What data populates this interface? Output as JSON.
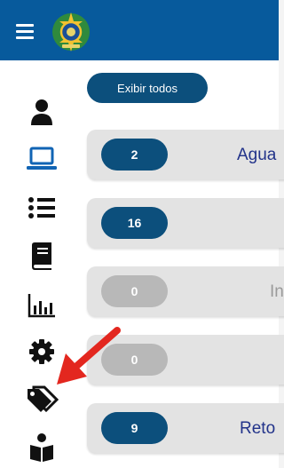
{
  "header": {
    "menu_icon": "hamburger-menu-icon",
    "emblem_icon": "brazil-coat-of-arms",
    "background_color": "#075a9c"
  },
  "sidebar": {
    "items": [
      {
        "icon": "user-icon",
        "active": false
      },
      {
        "icon": "laptop-icon",
        "active": true
      },
      {
        "icon": "list-icon",
        "active": false
      },
      {
        "icon": "book-icon",
        "active": false
      },
      {
        "icon": "bar-chart-icon",
        "active": false
      },
      {
        "icon": "gear-icon",
        "active": false
      },
      {
        "icon": "tags-icon",
        "active": false
      },
      {
        "icon": "reading-person-icon",
        "active": false
      }
    ]
  },
  "main": {
    "show_all_label": "Exibir todos",
    "rows": [
      {
        "count": "2",
        "label": "Agua",
        "state": "active"
      },
      {
        "count": "16",
        "label": "",
        "state": "active"
      },
      {
        "count": "0",
        "label": "In",
        "state": "inactive"
      },
      {
        "count": "0",
        "label": "",
        "state": "inactive"
      },
      {
        "count": "9",
        "label": "Reto",
        "state": "active"
      }
    ]
  },
  "annotation": {
    "type": "red-arrow",
    "points_to": "tags-icon",
    "color": "#e3271f"
  },
  "colors": {
    "primary": "#0c4f7c",
    "active_icon": "#1164b4",
    "inactive_pill": "#b8b8b8",
    "row_background": "#e3e3e3"
  }
}
